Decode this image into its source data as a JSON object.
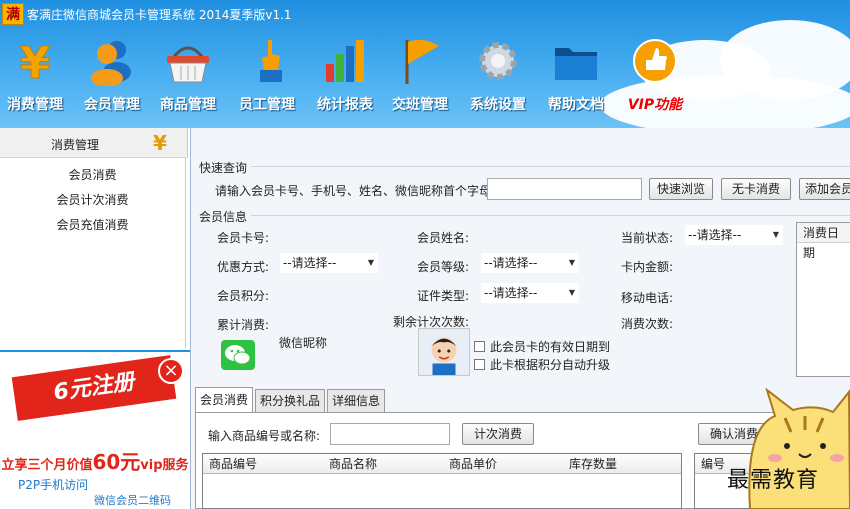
{
  "app": {
    "logo_char": "满",
    "title": "客满庄微信商城会员卡管理系统 2014夏季版v1.1"
  },
  "toolbar": {
    "items": [
      {
        "label": "消费管理",
        "icon": "yen-icon"
      },
      {
        "label": "会员管理",
        "icon": "members-icon"
      },
      {
        "label": "商品管理",
        "icon": "basket-icon"
      },
      {
        "label": "员工管理",
        "icon": "staff-icon"
      },
      {
        "label": "统计报表",
        "icon": "bar-chart-icon"
      },
      {
        "label": "交班管理",
        "icon": "flag-icon"
      },
      {
        "label": "系统设置",
        "icon": "gear-icon"
      },
      {
        "label": "帮助文档",
        "icon": "folder-icon"
      },
      {
        "label": "VIP功能",
        "icon": "thumbs-up-icon"
      }
    ]
  },
  "sidebar": {
    "header": "消费管理",
    "items": [
      {
        "label": "会员消费"
      },
      {
        "label": "会员计次消费"
      },
      {
        "label": "会员充值消费"
      }
    ]
  },
  "ad": {
    "banner": "6元注册",
    "close": "×",
    "promo_prefix": "立享三个月价值",
    "promo_price": "60元",
    "promo_suffix": "vip服务",
    "p2p_link": "P2P手机访问",
    "qr_link": "微信会员二维码"
  },
  "quick_query": {
    "legend": "快速查询",
    "prompt": "请输入会员卡号、手机号、姓名、微信昵称首个字母",
    "value": "",
    "browse_button": "快速浏览",
    "nocard_button": "无卡消费",
    "add_button": "添加会员"
  },
  "member_info": {
    "legend": "会员信息",
    "card_no_label": "会员卡号:",
    "name_label": "会员姓名:",
    "status_label": "当前状态:",
    "status_value": "--请选择--",
    "discount_label": "优惠方式:",
    "discount_value": "--请选择--",
    "level_label": "会员等级:",
    "level_value": "--请选择--",
    "balance_label": "卡内金额:",
    "points_label": "会员积分:",
    "idtype_label": "证件类型:",
    "idtype_value": "--请选择--",
    "mobile_label": "移动电话:",
    "total_label": "累计消费:",
    "remaining_label": "剩余计次次数:",
    "count_label": "消费次数:",
    "wechat_nick_label": "微信昵称",
    "check_expiry": "此会员卡的有效日期到",
    "check_upgrade": "此卡根据积分自动升级",
    "date_column": "消费日期"
  },
  "tabs": [
    {
      "label": "会员消费",
      "active": true
    },
    {
      "label": "积分换礼品",
      "active": false
    },
    {
      "label": "详细信息",
      "active": false
    }
  ],
  "consume": {
    "input_label": "输入商品编号或名称:",
    "input_value": "",
    "count_button": "计次消费",
    "confirm_button": "确认消费",
    "columns": [
      "商品编号",
      "商品名称",
      "商品单价",
      "库存数量"
    ],
    "right_columns": [
      "编号"
    ]
  },
  "watermark": "最需教育"
}
